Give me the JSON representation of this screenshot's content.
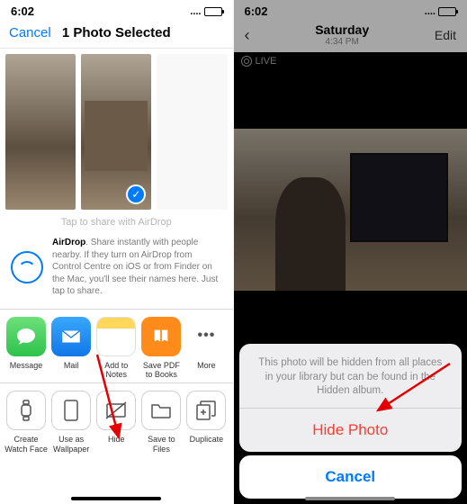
{
  "left": {
    "status": {
      "time": "6:02",
      "dots": "....",
      "battery_pct": 55
    },
    "nav": {
      "cancel": "Cancel",
      "title": "1 Photo Selected"
    },
    "tap_share": "Tap to share with AirDrop",
    "airdrop": {
      "bold": "AirDrop",
      "text": ". Share instantly with people nearby. If they turn on AirDrop from Control Centre on iOS or from Finder on the Mac, you'll see their names here. Just tap to share."
    },
    "apps": [
      {
        "label": "Message"
      },
      {
        "label": "Mail"
      },
      {
        "label": "Add to Notes"
      },
      {
        "label": "Save PDF\nto Books"
      },
      {
        "label": "More"
      }
    ],
    "sys": [
      {
        "label": "Create\nWatch Face"
      },
      {
        "label": "Use as\nWallpaper"
      },
      {
        "label": "Hide"
      },
      {
        "label": "Save to Files"
      },
      {
        "label": "Duplicate"
      }
    ]
  },
  "right": {
    "status": {
      "time": "6:02",
      "dots": "....",
      "battery_pct": 55
    },
    "nav": {
      "back": "‹",
      "title": "Saturday",
      "subtitle": "4:34 PM",
      "edit": "Edit"
    },
    "live": "LIVE",
    "sheet": {
      "message": "This photo will be hidden from all places in your library but can be found in the Hidden album.",
      "hide": "Hide Photo",
      "cancel": "Cancel"
    }
  }
}
